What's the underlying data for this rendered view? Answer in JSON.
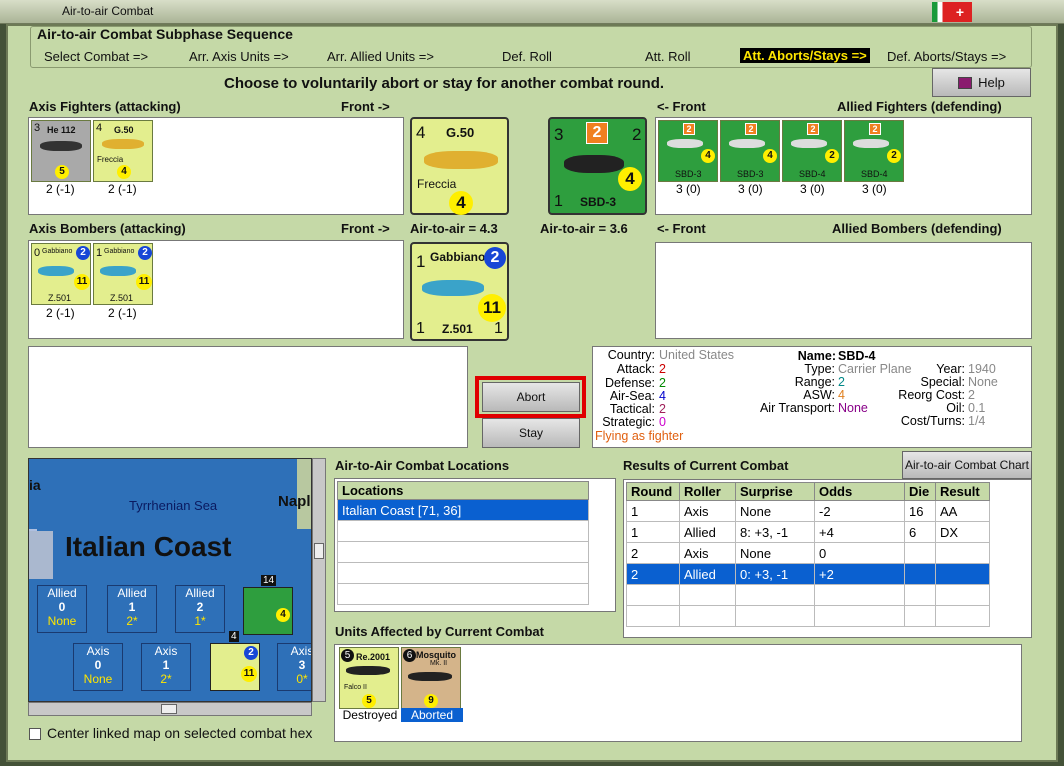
{
  "window": {
    "title": "Air-to-air Combat"
  },
  "phases": {
    "heading": "Air-to-air Combat Subphase Sequence",
    "items": [
      "Select Combat =>",
      "Arr. Axis Units =>",
      "Arr. Allied Units =>",
      "Def. Roll",
      "Att. Roll",
      "Att. Aborts/Stays =>",
      "Def. Aborts/Stays =>"
    ],
    "active_index": 5
  },
  "instruction": "Choose to voluntarily abort or stay for another combat round.",
  "help_label": "Help",
  "labels": {
    "axis_fighters": "Axis Fighters (attacking)",
    "front_right": "Front ->",
    "front_left": "<- Front",
    "allied_fighters": "Allied Fighters (defending)",
    "axis_bombers": "Axis Bombers (attacking)",
    "axis_a2a": "Air-to-air = 4.3",
    "allied_a2a": "Air-to-air = 3.6",
    "allied_bombers": "Allied Bombers (defending)"
  },
  "axis_fighters": [
    {
      "name": "He 112",
      "left": "3",
      "val": "5",
      "score": "2 (-1)",
      "color": "#a9a9a9"
    },
    {
      "name": "G.50",
      "sub": "Freccia",
      "left": "4",
      "val": "4",
      "score": "2 (-1)",
      "color": "#e3ee8e"
    }
  ],
  "axis_front_fighter": {
    "name": "G.50",
    "sub": "Freccia",
    "left": "4",
    "val": "4"
  },
  "allied_front_fighter": {
    "name": "SBD-3",
    "left": "3",
    "top": "2",
    "right": "2",
    "val": "4",
    "bottom": "1"
  },
  "allied_fighters": [
    {
      "name": "SBD-3",
      "val": "4",
      "score": "3 (0)"
    },
    {
      "name": "SBD-3",
      "val": "4",
      "score": "3 (0)"
    },
    {
      "name": "SBD-4",
      "val": "2",
      "score": "3 (0)"
    },
    {
      "name": "SBD-4",
      "val": "2",
      "score": "3 (0)"
    }
  ],
  "axis_bombers": [
    {
      "name": "Gabbiano",
      "sub": "Z.501",
      "left": "0",
      "blue": "2",
      "val": "11",
      "score": "2 (-1)"
    },
    {
      "name": "Gabbiano",
      "sub": "Z.501",
      "left": "1",
      "blue": "2",
      "val": "11",
      "score": "2 (-1)"
    }
  ],
  "axis_front_bomber": {
    "name": "Gabbiano",
    "sub": "Z.501",
    "left": "1",
    "blue": "2",
    "val": "11",
    "bottom_left": "1",
    "bottom_right": "1"
  },
  "buttons": {
    "abort": "Abort",
    "stay": "Stay",
    "chart": "Air-to-air Combat Chart"
  },
  "unit_info": {
    "country_k": "Country:",
    "country_v": "United States",
    "attack_k": "Attack:",
    "attack_v": "2",
    "defense_k": "Defense:",
    "defense_v": "2",
    "airsea_k": "Air-Sea:",
    "airsea_v": "4",
    "tactical_k": "Tactical:",
    "tactical_v": "2",
    "strategic_k": "Strategic:",
    "strategic_v": "0",
    "flying": "Flying as fighter",
    "name_k": "Name:",
    "name_v": "SBD-4",
    "type_k": "Type:",
    "type_v": "Carrier Plane",
    "year_k": "Year:",
    "year_v": "1940",
    "range_k": "Range:",
    "range_v": "2",
    "special_k": "Special:",
    "special_v": "None",
    "asw_k": "ASW:",
    "asw_v": "4",
    "reorg_k": "Reorg Cost:",
    "reorg_v": "2",
    "airtrans_k": "Air Transport:",
    "airtrans_v": "None",
    "oil_k": "Oil:",
    "oil_v": "0.1",
    "cost_k": "Cost/Turns:",
    "cost_v": "1/4"
  },
  "map": {
    "title": "Italian Coast",
    "sea": "Tyrrhenian Sea",
    "napl": "Napl",
    "ia": "ia",
    "counter_stack": "14",
    "stack2": "4",
    "boxes": [
      {
        "side": "Allied",
        "n": "0",
        "v": "None"
      },
      {
        "side": "Allied",
        "n": "1",
        "v": "2*"
      },
      {
        "side": "Allied",
        "n": "2",
        "v": "1*"
      },
      {
        "side": "Axis",
        "n": "0",
        "v": "None"
      },
      {
        "side": "Axis",
        "n": "1",
        "v": "2*"
      },
      {
        "side": "Axis",
        "n": "3",
        "v": "0*"
      }
    ]
  },
  "locations": {
    "heading": "Air-to-Air Combat Locations",
    "col": "Locations",
    "rows": [
      "Italian Coast [71, 36]"
    ]
  },
  "results": {
    "heading": "Results of Current Combat",
    "cols": [
      "Round",
      "Roller",
      "Surprise",
      "Odds",
      "Die",
      "Result"
    ],
    "rows": [
      [
        "1",
        "Axis",
        "None",
        "-2",
        "16",
        "AA"
      ],
      [
        "1",
        "Allied",
        "8: +3, -1",
        "+4",
        "6",
        "DX"
      ],
      [
        "2",
        "Axis",
        "None",
        "0",
        "",
        ""
      ],
      [
        "2",
        "Allied",
        "0: +3, -1",
        "+2",
        "",
        ""
      ]
    ],
    "selected": 3
  },
  "affected": {
    "heading": "Units Affected by Current Combat",
    "units": [
      {
        "num": "5",
        "name": "Re.2001",
        "sub": "Falco II",
        "val": "5",
        "status": "Destroyed"
      },
      {
        "num": "6",
        "name": "Mosquito",
        "sub": "Mk. II",
        "val": "9",
        "status": "Aborted"
      }
    ]
  },
  "checkbox": "Center linked map on selected combat hex",
  "colors": {
    "bg": "#c5d9a7",
    "counter_green": "#2e9e3e",
    "axis_yellow": "#e3ee8e",
    "select": "#0a60d0",
    "abort_border": "#e00000"
  }
}
